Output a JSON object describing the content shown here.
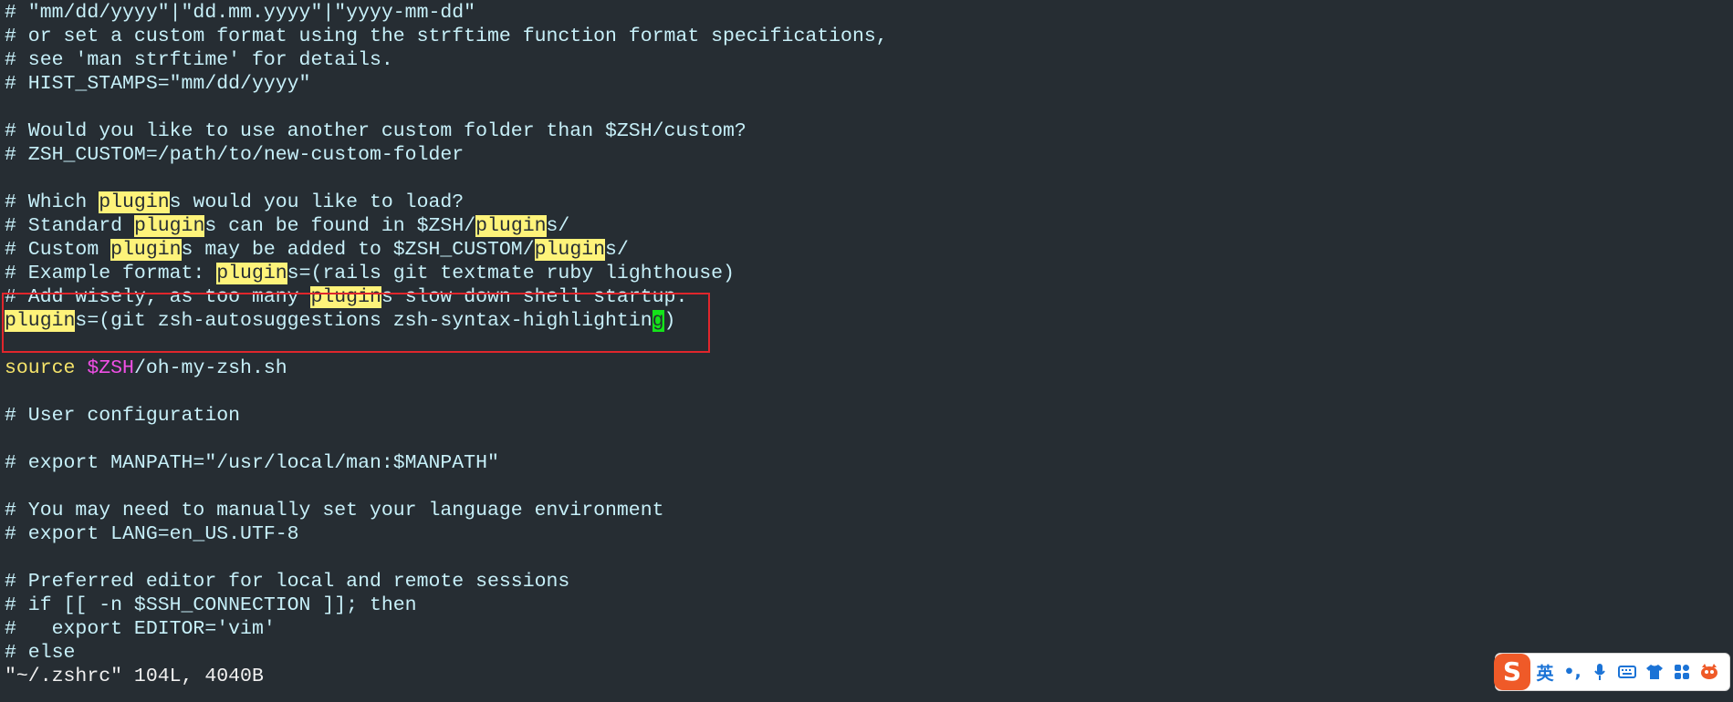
{
  "editor": {
    "lines": [
      {
        "segments": [
          {
            "text": "# \"mm/dd/yyyy\"|\"dd.mm.yyyy\"|\"yyyy-mm-dd\"",
            "style": "plain"
          }
        ]
      },
      {
        "segments": [
          {
            "text": "# or set a custom format using the strftime function format specifications,",
            "style": "plain"
          }
        ]
      },
      {
        "segments": [
          {
            "text": "# see 'man strftime' for details.",
            "style": "plain"
          }
        ]
      },
      {
        "segments": [
          {
            "text": "# HIST_STAMPS=\"mm/dd/yyyy\"",
            "style": "plain"
          }
        ]
      },
      {
        "segments": [
          {
            "text": "",
            "style": "plain"
          }
        ]
      },
      {
        "segments": [
          {
            "text": "# Would you like to use another custom folder than $ZSH/custom?",
            "style": "plain"
          }
        ]
      },
      {
        "segments": [
          {
            "text": "# ZSH_CUSTOM=/path/to/new-custom-folder",
            "style": "plain"
          }
        ]
      },
      {
        "segments": [
          {
            "text": "",
            "style": "plain"
          }
        ]
      },
      {
        "segments": [
          {
            "text": "# Which ",
            "style": "plain"
          },
          {
            "text": "plugin",
            "style": "hl"
          },
          {
            "text": "s would you like to load?",
            "style": "plain"
          }
        ]
      },
      {
        "segments": [
          {
            "text": "# Standard ",
            "style": "plain"
          },
          {
            "text": "plugin",
            "style": "hl"
          },
          {
            "text": "s can be found in $ZSH/",
            "style": "plain"
          },
          {
            "text": "plugin",
            "style": "hl"
          },
          {
            "text": "s/",
            "style": "plain"
          }
        ]
      },
      {
        "segments": [
          {
            "text": "# Custom ",
            "style": "plain"
          },
          {
            "text": "plugin",
            "style": "hl"
          },
          {
            "text": "s may be added to $ZSH_CUSTOM/",
            "style": "plain"
          },
          {
            "text": "plugin",
            "style": "hl"
          },
          {
            "text": "s/",
            "style": "plain"
          }
        ]
      },
      {
        "segments": [
          {
            "text": "# Example format: ",
            "style": "plain"
          },
          {
            "text": "plugin",
            "style": "hl"
          },
          {
            "text": "s=(rails git textmate ruby lighthouse)",
            "style": "plain"
          }
        ]
      },
      {
        "segments": [
          {
            "text": "# Add wisely, as too many ",
            "style": "plain"
          },
          {
            "text": "plugin",
            "style": "hl"
          },
          {
            "text": "s slow down shell startup.",
            "style": "plain"
          }
        ]
      },
      {
        "segments": [
          {
            "text": "plugin",
            "style": "hl"
          },
          {
            "text": "s=(git zsh-autosuggestions zsh-syntax-highlightin",
            "style": "plain"
          },
          {
            "text": "g",
            "style": "cursor"
          },
          {
            "text": ")",
            "style": "plain"
          }
        ]
      },
      {
        "segments": [
          {
            "text": "",
            "style": "plain"
          }
        ]
      },
      {
        "segments": [
          {
            "text": "source",
            "style": "kw-source"
          },
          {
            "text": " ",
            "style": "plain"
          },
          {
            "text": "$ZSH",
            "style": "kw-var"
          },
          {
            "text": "/oh-my-zsh.sh",
            "style": "plain"
          }
        ]
      },
      {
        "segments": [
          {
            "text": "",
            "style": "plain"
          }
        ]
      },
      {
        "segments": [
          {
            "text": "# User configuration",
            "style": "plain"
          }
        ]
      },
      {
        "segments": [
          {
            "text": "",
            "style": "plain"
          }
        ]
      },
      {
        "segments": [
          {
            "text": "# export MANPATH=\"/usr/local/man:$MANPATH\"",
            "style": "plain"
          }
        ]
      },
      {
        "segments": [
          {
            "text": "",
            "style": "plain"
          }
        ]
      },
      {
        "segments": [
          {
            "text": "# You may need to manually set your language environment",
            "style": "plain"
          }
        ]
      },
      {
        "segments": [
          {
            "text": "# export LANG=en_US.UTF-8",
            "style": "plain"
          }
        ]
      },
      {
        "segments": [
          {
            "text": "",
            "style": "plain"
          }
        ]
      },
      {
        "segments": [
          {
            "text": "# Preferred editor for local and remote sessions",
            "style": "plain"
          }
        ]
      },
      {
        "segments": [
          {
            "text": "# if [[ -n $SSH_CONNECTION ]]; then",
            "style": "plain"
          }
        ]
      },
      {
        "segments": [
          {
            "text": "#   export EDITOR='vim'",
            "style": "plain"
          }
        ]
      },
      {
        "segments": [
          {
            "text": "# else",
            "style": "plain"
          }
        ]
      }
    ],
    "status_line": "\"~/.zshrc\" 104L, 4040B"
  },
  "ime_toolbar": {
    "logo_text": "S",
    "mode_label": "英",
    "punct_label": "•,",
    "items": [
      "microphone-icon",
      "keyboard-icon",
      "skin-shirt-icon",
      "toolbox-grid-icon",
      "mascot-icon"
    ]
  },
  "colors": {
    "background": "#262d33",
    "text": "#c7f0f9",
    "search_highlight": "#fef37a",
    "cursor": "#14e31a",
    "source_keyword": "#f5e36a",
    "variable": "#f04fe6",
    "selection_box": "#e0262c",
    "ime_logo": "#ef5a28",
    "ime_icons": "#1b73d6"
  }
}
